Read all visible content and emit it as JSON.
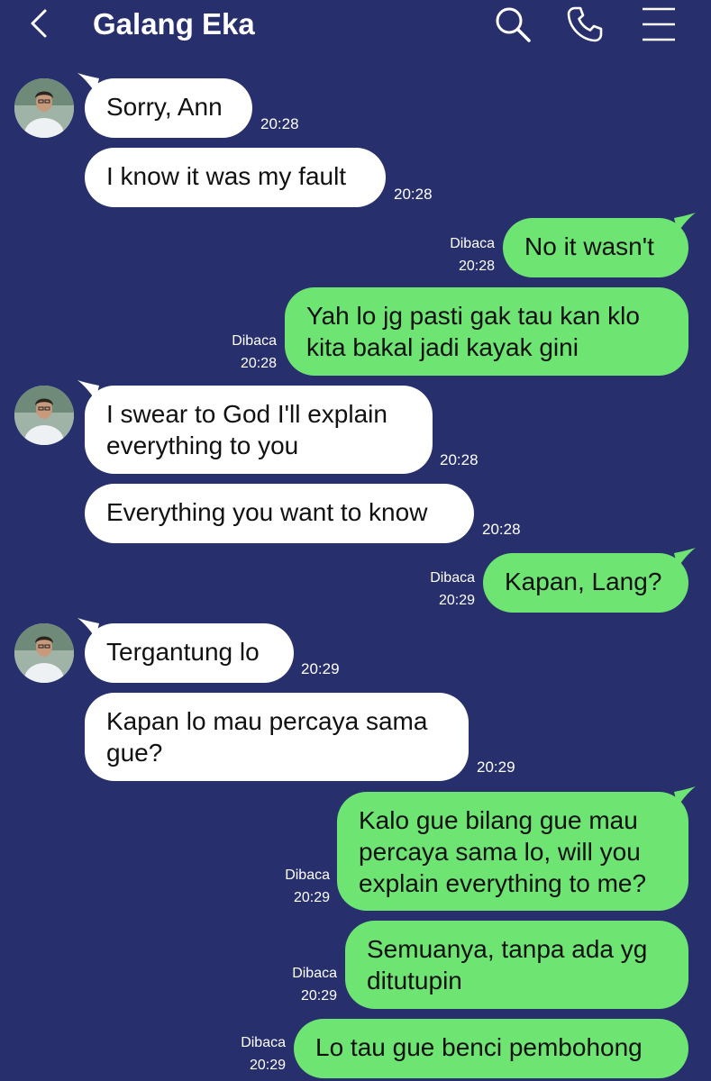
{
  "header": {
    "back_icon": "chevron-left-icon",
    "contact_name": "Galang Eka",
    "search_icon": "search-icon",
    "call_icon": "phone-icon",
    "menu_icon": "menu-icon"
  },
  "colors": {
    "background": "#27306d",
    "incoming_bubble": "#ffffff",
    "outgoing_bubble": "#6ee472",
    "text_light": "#ffffff"
  },
  "read_label": "Dibaca",
  "messages": [
    {
      "direction": "in",
      "text": "Sorry, Ann",
      "time": "20:28"
    },
    {
      "direction": "in",
      "text": "I know it was my fault",
      "time": "20:28"
    },
    {
      "direction": "out",
      "text": "No it wasn't",
      "time": "20:28",
      "status": "Dibaca"
    },
    {
      "direction": "out",
      "text": [
        "Yah lo jg pasti gak tau kan klo",
        "kita bakal jadi kayak gini"
      ],
      "time": "20:28",
      "status": "Dibaca"
    },
    {
      "direction": "in",
      "text": [
        "I swear to God I'll explain",
        "everything to you"
      ],
      "time": "20:28"
    },
    {
      "direction": "in",
      "text": "Everything you want to know",
      "time": "20:28"
    },
    {
      "direction": "out",
      "text": "Kapan, Lang?",
      "time": "20:29",
      "status": "Dibaca"
    },
    {
      "direction": "in",
      "text": "Tergantung lo",
      "time": "20:29"
    },
    {
      "direction": "in",
      "text": [
        "Kapan lo mau percaya sama",
        "gue?"
      ],
      "time": "20:29"
    },
    {
      "direction": "out",
      "text": [
        "Kalo gue bilang gue mau",
        "percaya sama lo, will you",
        "explain everything to me?"
      ],
      "time": "20:29",
      "status": "Dibaca"
    },
    {
      "direction": "out",
      "text": [
        "Semuanya, tanpa ada yg",
        "ditutupin"
      ],
      "time": "20:29",
      "status": "Dibaca"
    },
    {
      "direction": "out",
      "text": "Lo tau gue benci pembohong",
      "time": "20:29",
      "status": "Dibaca"
    }
  ]
}
